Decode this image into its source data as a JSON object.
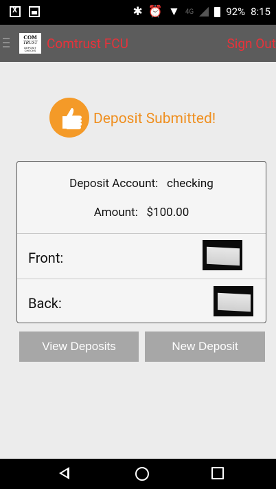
{
  "status_bar": {
    "battery": "92%",
    "time": "8:15",
    "network": "4G",
    "icons": [
      "photo-icon",
      "mail-icon",
      "bluetooth-icon",
      "alarm-icon",
      "wifi-icon",
      "signal-icon",
      "battery-icon"
    ]
  },
  "app_bar": {
    "logo_lines": [
      "COM",
      "TRUST",
      "DEPOSIT CHECKS"
    ],
    "title": "Comtrust FCU",
    "sign_out": "Sign Out"
  },
  "deposit": {
    "status": "Deposit Submitted!",
    "account_label": "Deposit Account:",
    "account_value": "checking",
    "amount_label": "Amount:",
    "amount_value": "$100.00",
    "front_label": "Front:",
    "back_label": "Back:"
  },
  "buttons": {
    "view": "View Deposits",
    "new": "New Deposit"
  },
  "colors": {
    "accent": "#ef8f1f",
    "title_red": "#e8323a",
    "toolbar": "#5c5c5c",
    "button": "#a7a7a7"
  }
}
